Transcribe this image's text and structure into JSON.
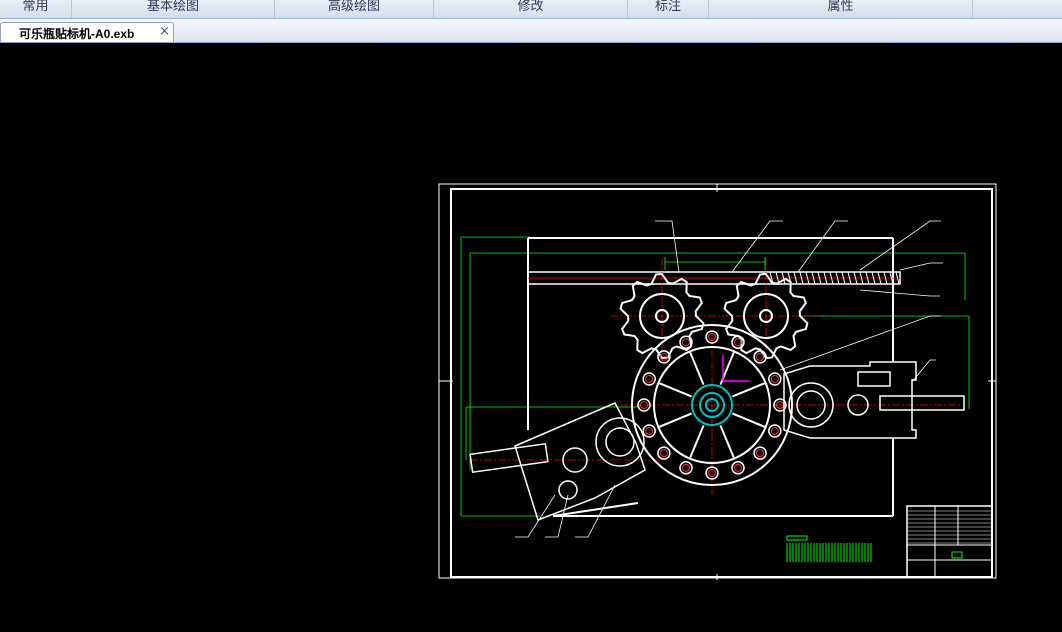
{
  "ribbon": {
    "tabs": [
      {
        "label": "常用"
      },
      {
        "label": "基本绘图"
      },
      {
        "label": "高级绘图"
      },
      {
        "label": "修改"
      },
      {
        "label": "标注"
      },
      {
        "label": "属性"
      }
    ]
  },
  "document": {
    "tab_label": "可乐瓶贴标机-A0.exb",
    "close_glyph": "×"
  },
  "drawing": {
    "background": "#000000",
    "line_color": "#ffffff",
    "center_line_color": "#ff0000",
    "dimension_color": "#00ff00",
    "axis_color": "#ff00ff",
    "hub_color": "#00c0c0"
  }
}
